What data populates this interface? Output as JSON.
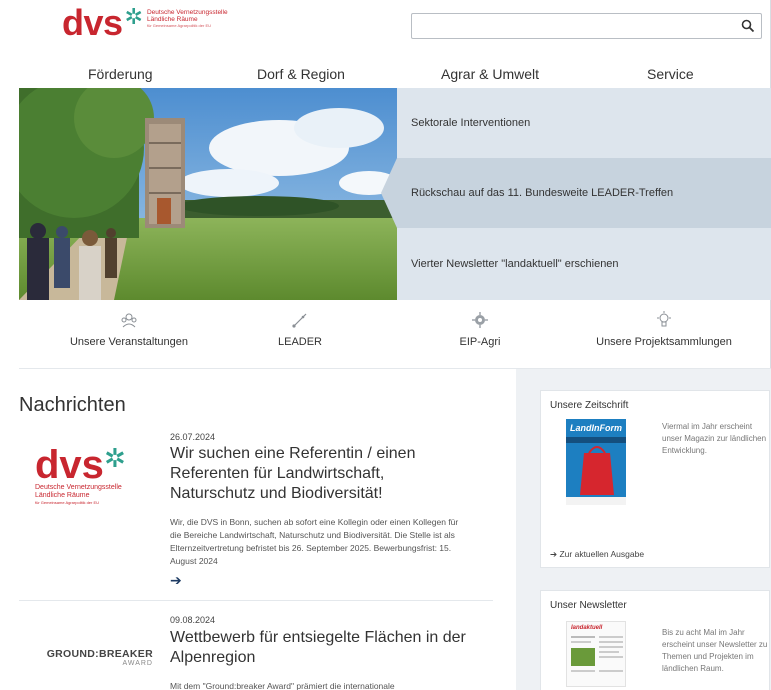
{
  "brand": {
    "wordmark": "dvs",
    "line1": "Deutsche Vernetzungsstelle",
    "line2": "Ländliche Räume",
    "line3": "für Gemeinsame Agrarpolitik der EU",
    "color": "#c8262f",
    "accent": "#2e9f8d"
  },
  "search": {
    "placeholder": "",
    "icon": "search-icon"
  },
  "nav": [
    "Förderung",
    "Dorf & Region",
    "Agrar & Umwelt",
    "Service"
  ],
  "hero": {
    "panels": [
      {
        "label": "Sektorale Interventionen",
        "active": false
      },
      {
        "label": "Rückschau auf das 11. Bundesweite LEADER-Treffen",
        "active": true
      },
      {
        "label": "Vierter Newsletter \"landaktuell\" erschienen",
        "active": false
      }
    ]
  },
  "quicklinks": [
    {
      "label": "Unsere Veranstaltungen",
      "icon": "events-icon"
    },
    {
      "label": "LEADER",
      "icon": "leader-icon"
    },
    {
      "label": "EIP-Agri",
      "icon": "eip-agri-icon"
    },
    {
      "label": "Unsere Projektsammlungen",
      "icon": "project-collection-icon"
    }
  ],
  "news": {
    "title": "Nachrichten",
    "items": [
      {
        "date": "26.07.2024",
        "title": "Wir suchen eine Referentin / einen Referenten für Landwirtschaft, Naturschutz und Biodiversität!",
        "text": "Wir, die DVS in Bonn, suchen ab sofort eine Kollegin oder einen Kollegen für die Bereiche Landwirtschaft, Naturschutz und Biodiversität. Die Stelle ist als Elternzeitvertretung befristet bis 26. September 2025. Bewerbungsfrist: 15. August 2024",
        "more": "➔"
      },
      {
        "date": "09.08.2024",
        "title": "Wettbewerb für entsiegelte Flächen in der Alpenregion",
        "text": "Mit dem \"Ground:breaker Award\" prämiert die internationale",
        "logo": "GROUND:BREAKER",
        "logo_sub": "AWARD"
      }
    ]
  },
  "sidebar": {
    "magazine": {
      "title": "Unsere Zeitschrift",
      "text": "Viermal im Jahr erscheint unser Magazin zur ländlichen Entwicklung.",
      "link": "➔ Zur aktuellen Ausgabe",
      "cover_title": "LandInForm"
    },
    "newsletter": {
      "title": "Unser Newsletter",
      "text": "Bis zu acht Mal im Jahr erscheint unser Newsletter zu Themen und Projekten im ländlichen Raum.",
      "cover_title": "landaktuell"
    }
  }
}
